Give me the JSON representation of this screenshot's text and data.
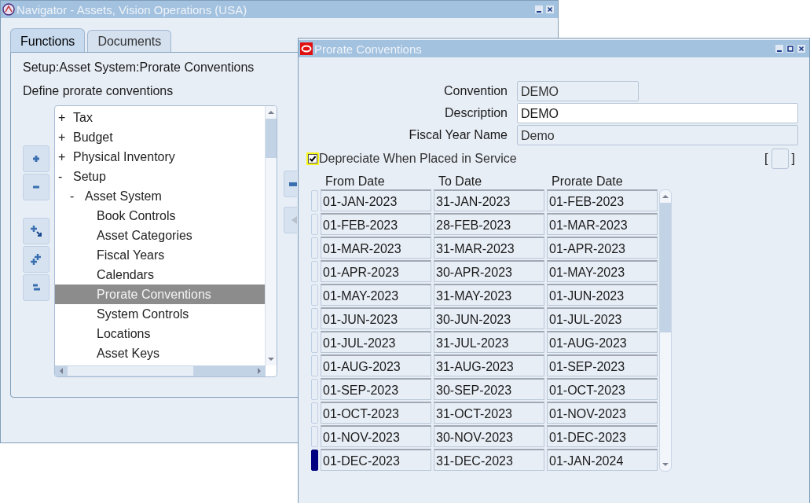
{
  "navigator": {
    "title": "Navigator - Assets, Vision Operations (USA)",
    "tabs": [
      {
        "label": "Functions",
        "selected": true
      },
      {
        "label": "Documents",
        "selected": false
      }
    ],
    "path": "Setup:Asset System:Prorate Conventions",
    "description": "Define prorate conventions",
    "tree": [
      {
        "sign": "+",
        "label": "Tax",
        "selected": false
      },
      {
        "sign": "+",
        "label": "Budget",
        "selected": false
      },
      {
        "sign": "+",
        "label": "Physical Inventory",
        "selected": false
      },
      {
        "sign": "-",
        "label": "Setup",
        "selected": false,
        "children": [
          {
            "sign": "-",
            "label": "Asset System",
            "selected": false,
            "children": [
              {
                "label": "Book Controls",
                "selected": false
              },
              {
                "label": "Asset Categories",
                "selected": false
              },
              {
                "label": "Fiscal Years",
                "selected": false
              },
              {
                "label": "Calendars",
                "selected": false
              },
              {
                "label": "Prorate Conventions",
                "selected": true
              },
              {
                "label": "System Controls",
                "selected": false
              },
              {
                "label": "Locations",
                "selected": false
              },
              {
                "label": "Asset Keys",
                "selected": false
              }
            ]
          }
        ]
      }
    ]
  },
  "form": {
    "title": "Prorate Conventions",
    "fields": [
      {
        "label": "Convention",
        "value": "DEMO",
        "kind": "readonly"
      },
      {
        "label": "Description",
        "value": "DEMO",
        "kind": "editable"
      },
      {
        "label": "Fiscal Year Name",
        "value": "Demo",
        "kind": "readonly"
      }
    ],
    "checkbox": {
      "label": "Depreciate When Placed in Service",
      "checked": true
    },
    "bracket_open": "[",
    "bracket_close": "]",
    "table": {
      "columns": [
        "From Date",
        "To Date",
        "Prorate Date"
      ],
      "rows": [
        {
          "cells": [
            "01-JAN-2023",
            "31-JAN-2023",
            "01-FEB-2023"
          ],
          "selected": false
        },
        {
          "cells": [
            "01-FEB-2023",
            "28-FEB-2023",
            "01-MAR-2023"
          ],
          "selected": false
        },
        {
          "cells": [
            "01-MAR-2023",
            "31-MAR-2023",
            "01-APR-2023"
          ],
          "selected": false
        },
        {
          "cells": [
            "01-APR-2023",
            "30-APR-2023",
            "01-MAY-2023"
          ],
          "selected": false
        },
        {
          "cells": [
            "01-MAY-2023",
            "31-MAY-2023",
            "01-JUN-2023"
          ],
          "selected": false
        },
        {
          "cells": [
            "01-JUN-2023",
            "30-JUN-2023",
            "01-JUL-2023"
          ],
          "selected": false
        },
        {
          "cells": [
            "01-JUL-2023",
            "31-JUL-2023",
            "01-AUG-2023"
          ],
          "selected": false
        },
        {
          "cells": [
            "01-AUG-2023",
            "31-AUG-2023",
            "01-SEP-2023"
          ],
          "selected": false
        },
        {
          "cells": [
            "01-SEP-2023",
            "30-SEP-2023",
            "01-OCT-2023"
          ],
          "selected": false
        },
        {
          "cells": [
            "01-OCT-2023",
            "31-OCT-2023",
            "01-NOV-2023"
          ],
          "selected": false
        },
        {
          "cells": [
            "01-NOV-2023",
            "30-NOV-2023",
            "01-DEC-2023"
          ],
          "selected": false
        },
        {
          "cells": [
            "01-DEC-2023",
            "31-DEC-2023",
            "01-JAN-2024"
          ],
          "selected": true
        }
      ]
    }
  }
}
